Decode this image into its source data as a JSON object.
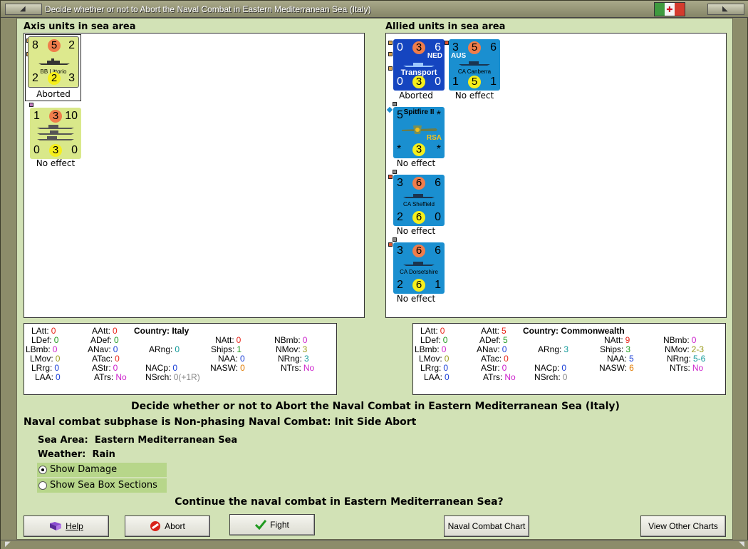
{
  "window": {
    "title": "Decide whether or not to Abort the Naval Combat in Eastern Mediterranean Sea (Italy)",
    "flag_symbol": "✚"
  },
  "axis": {
    "label": "Axis units in sea area",
    "units": [
      {
        "name": "BB Littorio",
        "tl": "8",
        "top": "5",
        "tr": "2",
        "bl": "2",
        "bot": "2",
        "br": "3",
        "status": "Aborted"
      },
      {
        "name": "",
        "tl": "1",
        "top": "3",
        "tr": "10",
        "bl": "0",
        "bot": "3",
        "br": "0",
        "status": "No effect"
      }
    ],
    "stats": {
      "LAtt": "0",
      "LDef": "0",
      "LBmb": "0",
      "LMov": "0",
      "LRrg": "0",
      "LAA": "0",
      "AAtt": "0",
      "ADef": "0",
      "ANav": "0",
      "ATac": "0",
      "AStr": "0",
      "ATrs": "No",
      "country_label": "Country:",
      "country": "Italy",
      "ARng": "0",
      "NAtt": "0",
      "Ships": "1",
      "NAA": "0",
      "NASW": "0",
      "NACp": "0",
      "NSrch": "0(+1R)",
      "NBmb": "0",
      "NMov": "3",
      "NRng": "3",
      "NTrs": "No"
    }
  },
  "allied": {
    "label": "Allied units in sea area",
    "units": [
      {
        "name": "Transport",
        "tag": "NED",
        "tl": "0",
        "top": "3",
        "tr": "6",
        "bl": "0",
        "bot": "3",
        "br": "0",
        "status": "Aborted"
      },
      {
        "name": "CA Canberra",
        "tag": "AUS",
        "tl": "3",
        "top": "5",
        "tr": "6",
        "bl": "1",
        "bot": "5",
        "br": "1",
        "status": "No effect"
      },
      {
        "name": "Spitfire II",
        "tag": "RSA",
        "tl": "5",
        "tr": "*",
        "bl": "*",
        "bot": "3",
        "br": "*",
        "status": "No effect"
      },
      {
        "name": "CA Sheffield",
        "tl": "3",
        "top": "6",
        "tr": "6",
        "bl": "2",
        "bot": "6",
        "br": "0",
        "status": "No effect"
      },
      {
        "name": "CA Dorsetshire",
        "tl": "3",
        "top": "6",
        "tr": "6",
        "bl": "2",
        "bot": "6",
        "br": "1",
        "status": "No effect"
      }
    ],
    "stats": {
      "LAtt": "0",
      "LDef": "0",
      "LBmb": "0",
      "LMov": "0",
      "LRrg": "0",
      "LAA": "0",
      "AAtt": "5",
      "ADef": "5",
      "ANav": "0",
      "ATac": "0",
      "AStr": "0",
      "ATrs": "No",
      "country_label": "Country:",
      "country": "Commonwealth",
      "ARng": "3",
      "NAtt": "9",
      "Ships": "3",
      "NAA": "5",
      "NASW": "6",
      "NACp": "0",
      "NSrch": "0",
      "NBmb": "0",
      "NMov": "2-3",
      "NRng": "5-6",
      "NTrs": "No"
    }
  },
  "headline": "Decide whether or not to Abort the Naval Combat in Eastern Mediterranean Sea (Italy)",
  "subphase": "Naval combat subphase is Non-phasing Naval Combat: Init Side Abort",
  "sea_area_label": "Sea Area:",
  "sea_area": "Eastern Mediterranean Sea",
  "weather_label": "Weather:",
  "weather": "Rain",
  "options": {
    "show_damage": "Show Damage",
    "show_sea_box": "Show Sea Box Sections"
  },
  "question": "Continue the naval combat in Eastern Mediterranean Sea?",
  "buttons": {
    "help": "Help",
    "abort": "Abort",
    "fight": "Fight",
    "naval_chart": "Naval Combat Chart",
    "other_charts": "View Other Charts"
  },
  "colors": {
    "red": "#e8261a",
    "green": "#1f9a1f",
    "blue": "#1a3fd6",
    "orange": "#e07a00",
    "magenta": "#cc22cc",
    "teal": "#129a9a",
    "olive": "#9a9a1a",
    "grey": "#888888"
  }
}
